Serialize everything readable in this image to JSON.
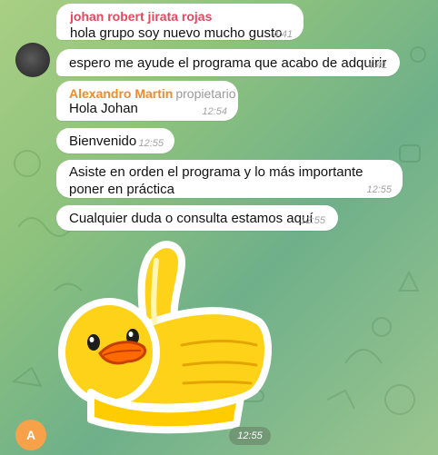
{
  "messages": [
    {
      "sender": "johan robert jirata rojas",
      "text": "hola grupo soy nuevo mucho gusto",
      "time": "4:41"
    },
    {
      "text": "espero me ayude el programa que acabo de adquirir",
      "time": "4:41"
    },
    {
      "sender": "Alexandro Martin",
      "role": "propietario",
      "text": "Hola Johan",
      "time": "12:54"
    },
    {
      "text": "Bienvenido",
      "time": "12:55"
    },
    {
      "text": "Asiste en orden el programa y lo más importante poner en práctica",
      "time": "12:55"
    },
    {
      "text": "Cualquier duda o consulta estamos aquí",
      "time": "12:55"
    },
    {
      "sticker": "thumbs-up-duck",
      "time": "12:55"
    }
  ],
  "avatars": {
    "bottom_initial": "A"
  },
  "colors": {
    "johan_name": "#e2495f",
    "alexandro_name": "#f08a2c",
    "avatar_orange": "#f7a24a",
    "bubble_bg": "#ffffff"
  }
}
